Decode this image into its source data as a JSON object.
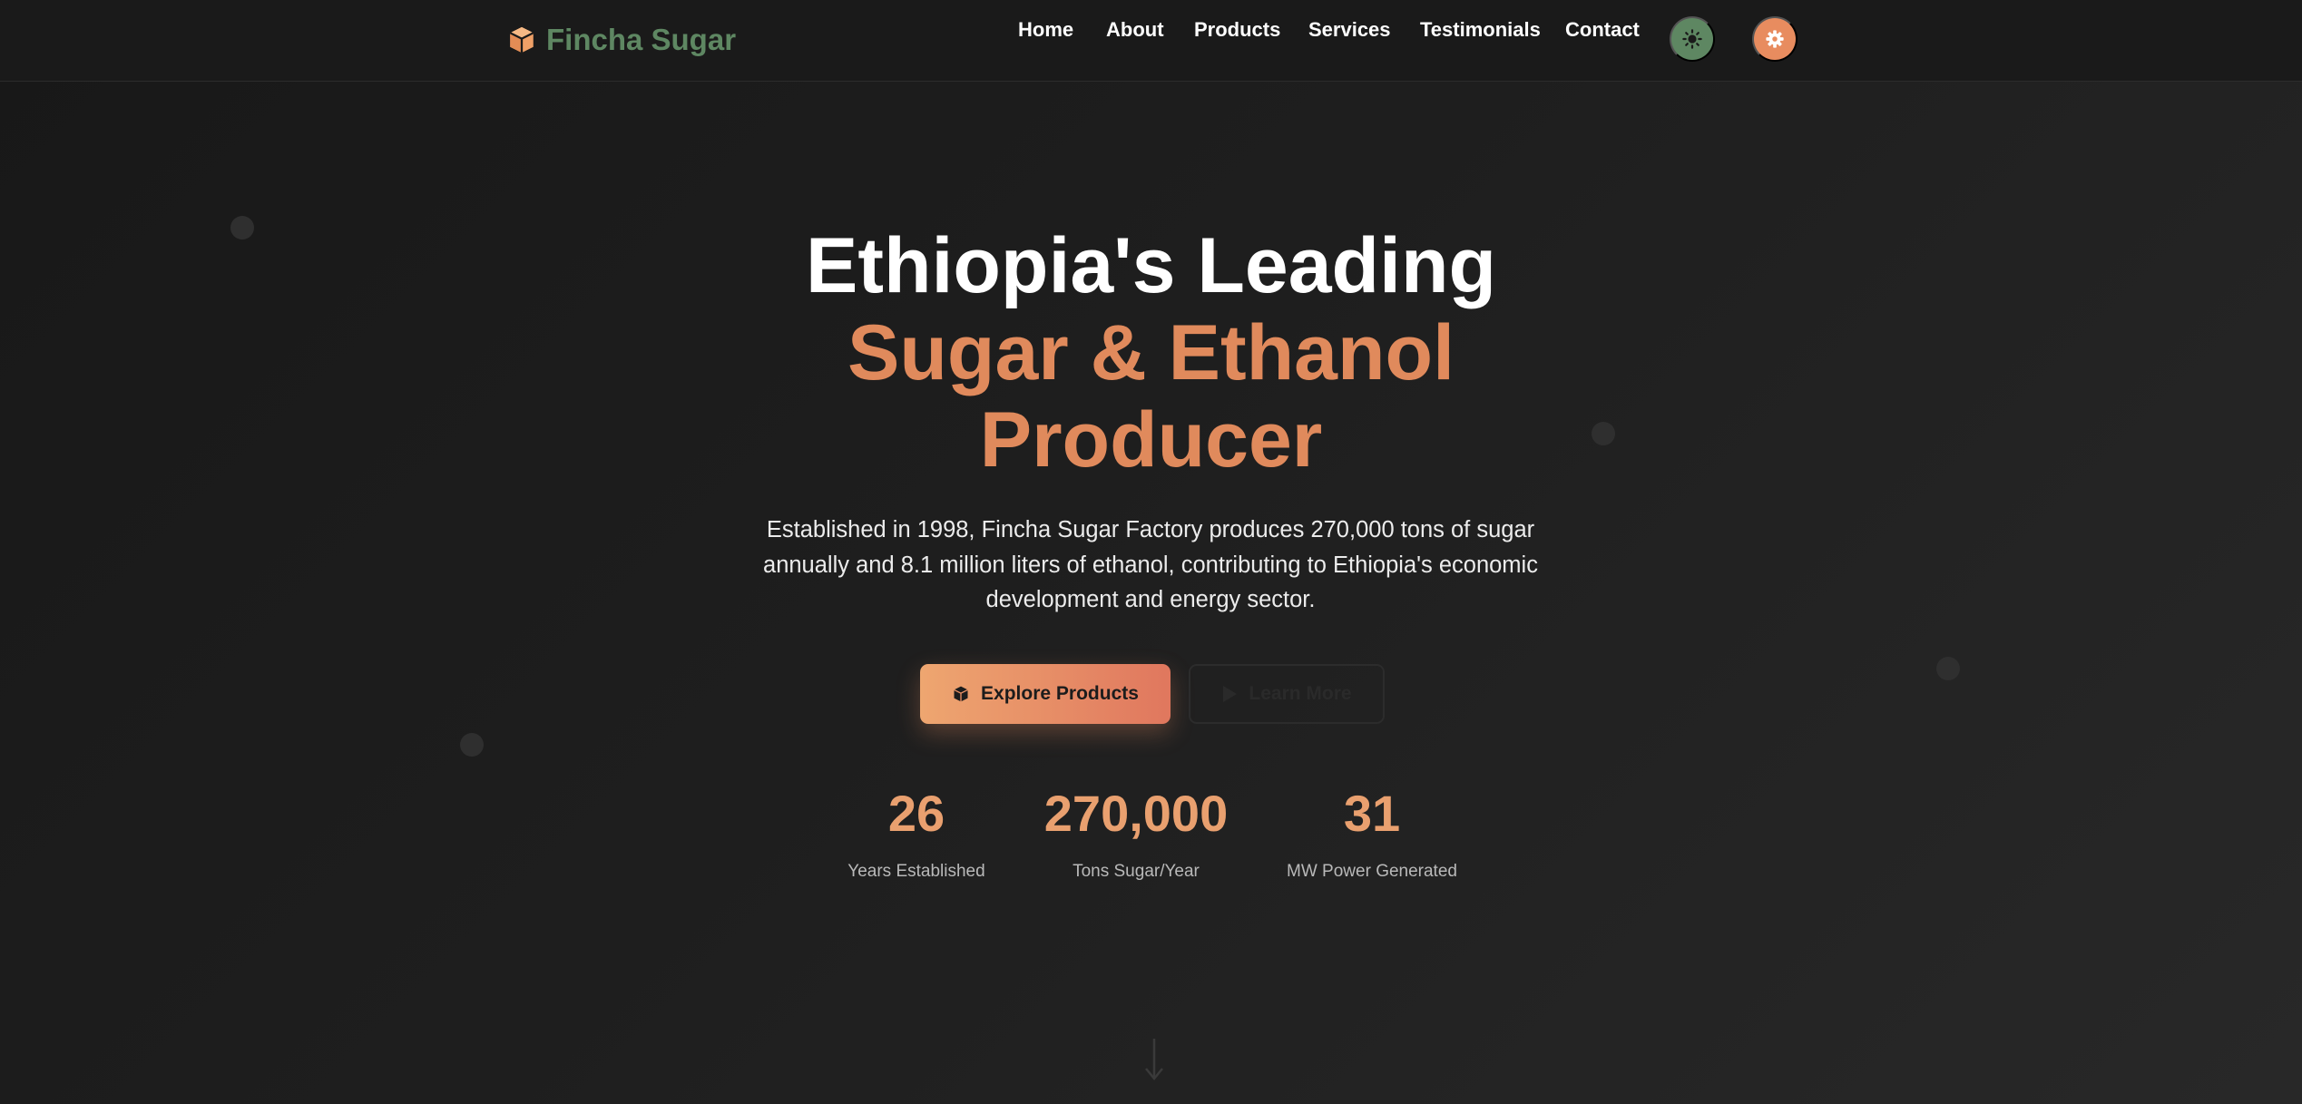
{
  "brand": {
    "name": "Fincha Sugar",
    "icon": "cube-icon",
    "color": "#5e8762"
  },
  "nav": {
    "links": [
      "Home",
      "About",
      "Products",
      "Services",
      "Testimonials",
      "Contact"
    ],
    "theme_toggle_icon": "sun-icon",
    "settings_icon": "gear-icon"
  },
  "hero": {
    "title_line1": "Ethiopia's Leading",
    "title_line2": "Sugar & Ethanol",
    "title_line3": "Producer",
    "description": "Established in 1998, Fincha Sugar Factory produces 270,000 tons of sugar annually and 8.1 million liters of ethanol, contributing to Ethiopia's economic development and energy sector.",
    "primary_button": {
      "label": "Explore Products",
      "icon": "cube-icon"
    },
    "secondary_button": {
      "label": "Learn More",
      "icon": "play-icon"
    }
  },
  "stats": [
    {
      "value": "26",
      "label": "Years Established"
    },
    {
      "value": "270,000",
      "label": "Tons Sugar/Year"
    },
    {
      "value": "31",
      "label": "MW Power Generated"
    }
  ],
  "scroll_indicator_icon": "arrow-down-icon",
  "colors": {
    "accent": "#e08a5c",
    "accent_light": "#e9a06f",
    "green": "#5e8762",
    "background": "#1b1b1b"
  }
}
